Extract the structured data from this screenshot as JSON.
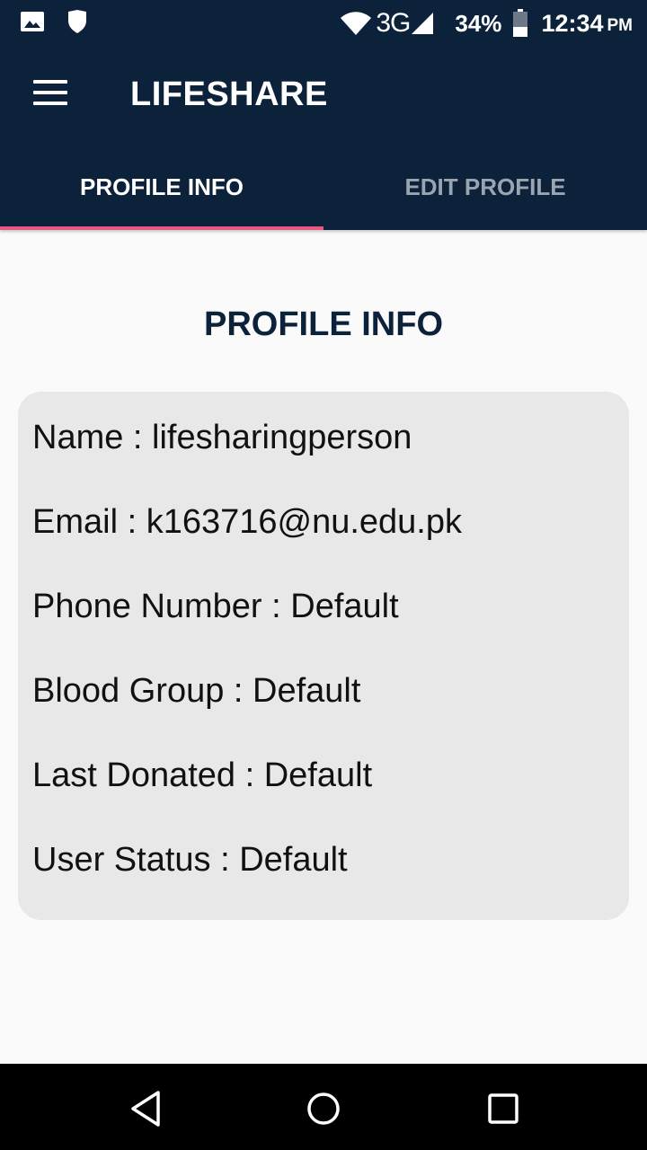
{
  "status_bar": {
    "network": "3G",
    "battery": "34%",
    "time": "12:34",
    "ampm": "PM",
    "icons": [
      "image-icon",
      "shield-icon",
      "wifi-icon",
      "signal-icon",
      "battery-icon"
    ]
  },
  "app_bar": {
    "title": "LIFESHARE",
    "menu_icon": "menu-icon"
  },
  "tabs": [
    {
      "label": "PROFILE INFO",
      "active": true
    },
    {
      "label": "EDIT PROFILE",
      "active": false
    }
  ],
  "main": {
    "title": "PROFILE INFO",
    "fields": [
      "Name : lifesharingperson",
      "Email : k163716@nu.edu.pk",
      "Phone Number : Default",
      "Blood Group : Default",
      "Last Donated : Default",
      "User Status : Default"
    ]
  },
  "nav_bar": {
    "icons": [
      "back-icon",
      "home-icon",
      "recents-icon"
    ]
  },
  "colors": {
    "primary": "#0b223a",
    "accent": "#e8577f",
    "card": "#e8e8e8",
    "background": "#fafafa"
  }
}
